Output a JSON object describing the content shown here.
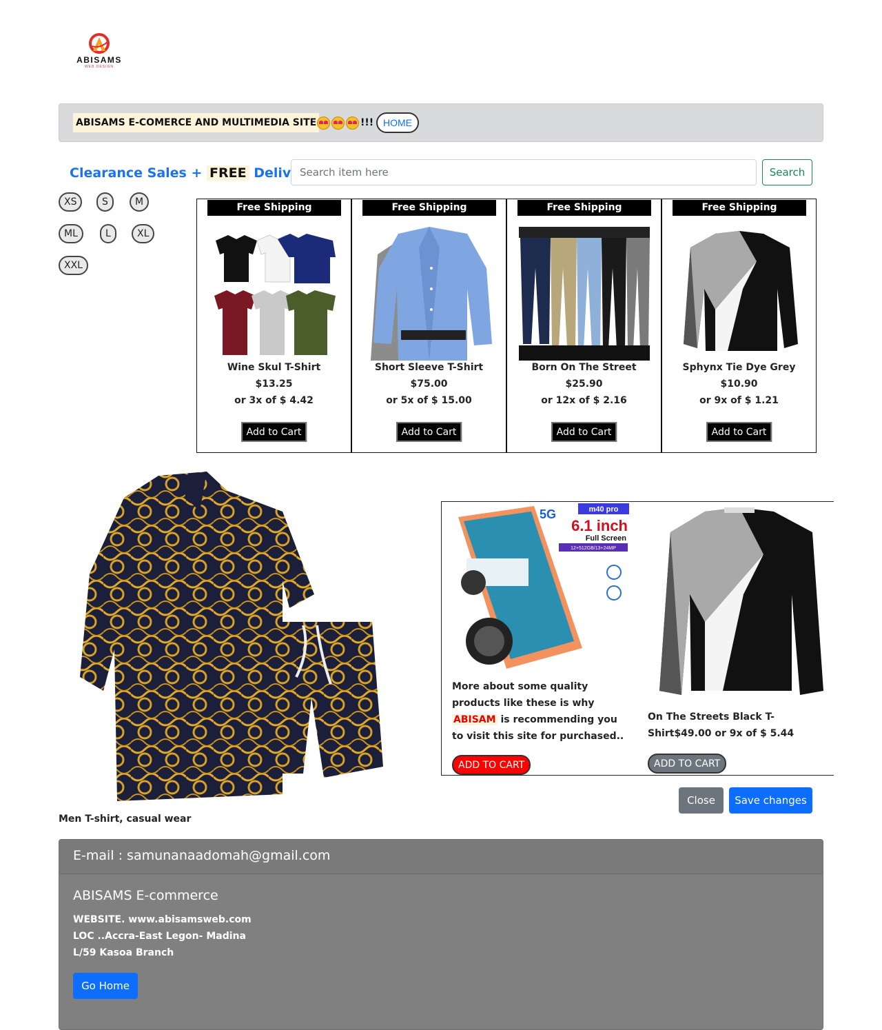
{
  "logo": {
    "name": "ABISAMS",
    "tagline": "WEB DESIGN"
  },
  "topbar": {
    "title": "ABISAMS E-COMERCE AND MULTIMEDIA SITE",
    "exclaim": "!!!",
    "home_label": "HOME"
  },
  "promo": {
    "part1": "Clearance Sales + ",
    "free": "FREE",
    "part2": " Delivery"
  },
  "search": {
    "placeholder": "Search item here",
    "button_label": "Search"
  },
  "sizes": [
    "XS",
    "S",
    "M",
    "ML",
    "L",
    "XL",
    "XXL"
  ],
  "products": [
    {
      "tag": "Free Shipping",
      "name": "Wine Skul T-Shirt",
      "price": "$13.25",
      "installment": "or 3x of $ 4.42",
      "button": "Add to Cart"
    },
    {
      "tag": "Free Shipping",
      "name": "Short Sleeve T-Shirt",
      "price": "$75.00",
      "installment": "or 5x of $ 15.00",
      "button": "Add to Cart"
    },
    {
      "tag": "Free Shipping",
      "name": "Born On The Street",
      "price": "$25.90",
      "installment": "or 12x of $ 2.16",
      "button": "Add to Cart"
    },
    {
      "tag": "Free Shipping",
      "name": "Sphynx Tie Dye Grey",
      "price": "$10.90",
      "installment": "or 9x of $ 1.21",
      "button": "Add to Cart"
    }
  ],
  "feature": {
    "caption": "Men T-shirt, casual wear"
  },
  "carousel": {
    "phone_badge": "m40 pro",
    "phone_network": "5G",
    "phone_size": "6.1 inch",
    "phone_screen": "Full Screen",
    "phone_memory": "12+512GB/13+24MP",
    "desc_before": "More about some quality products like these is why ",
    "desc_brand": "ABISAM",
    "desc_after": " is recommending you to visit this site for purchased..",
    "cart_red_label": "ADD TO CART",
    "sweater_desc": "On The Streets Black T-Shirt$49.00 or 9x of $ 5.44",
    "cart_grey_label": "ADD TO CART"
  },
  "modal_actions": {
    "close_label": "Close",
    "save_label": "Save changes"
  },
  "footer": {
    "email": "E-mail : samunanaadomah@gmail.com",
    "title": "ABISAMS E-commerce",
    "website": "WEBSITE. www.abisamsweb.com",
    "location": "LOC ..Accra-East Legon- Madina",
    "branch": "L/59 Kasoa Branch",
    "button_label": "Go Home"
  },
  "colors": {
    "accent_blue": "#0d6efd",
    "success_green": "#198754",
    "cart_red": "#ff0000",
    "footer_grey": "#808080"
  }
}
